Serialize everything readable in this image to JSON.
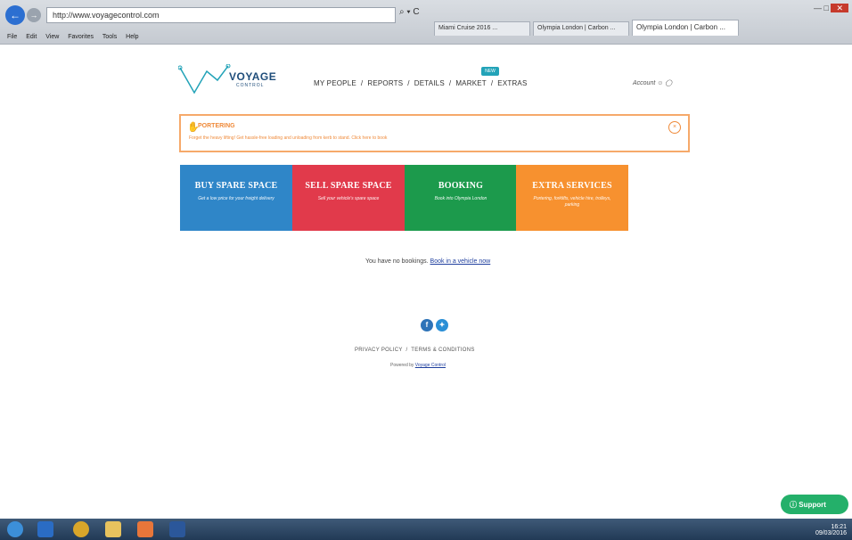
{
  "browser": {
    "address": "http://www.voyagecontrol.com",
    "search_icons": "⌕ ▾ C",
    "tabs": [
      {
        "label": "Miami Cruise 2016 ..."
      },
      {
        "label": "Olympia London | Carbon ..."
      },
      {
        "label": "Olympia London | Carbon ..."
      }
    ],
    "menu": [
      "File",
      "Edit",
      "View",
      "Favorites",
      "Tools",
      "Help"
    ]
  },
  "site": {
    "logo_text": "VOYAGE",
    "logo_sub": "CONTROL",
    "nav": [
      "MY PEOPLE",
      "REPORTS",
      "DETAILS",
      "MARKET",
      "EXTRAS"
    ],
    "nav_sep": "/",
    "new_badge": "NEW",
    "account": "Account"
  },
  "notice": {
    "title": "PORTERING",
    "text": "Forget the heavy lifting! Get hassle-free loading and unloading from kerb to stand. Click here to book"
  },
  "tiles": [
    {
      "title": "BUY SPARE SPACE",
      "desc": "Get a low price for your freight delivery"
    },
    {
      "title": "SELL SPARE SPACE",
      "desc": "Sell your vehicle's spare space"
    },
    {
      "title": "BOOKING",
      "desc": "Book into Olympia London"
    },
    {
      "title": "EXTRA SERVICES",
      "desc": "Portering, forklifts, vehicle hire, trolleys, parking"
    }
  ],
  "bookings": {
    "empty_text": "You have no bookings.",
    "link": "Book in a vehicle now"
  },
  "footer": {
    "privacy": "PRIVACY POLICY",
    "sep": "/",
    "terms": "TERMS & CONDITIONS",
    "powered_prefix": "Powered by",
    "powered_link": "Voyage Control"
  },
  "support_label": "Support",
  "colors": {
    "buy": "#2f86c8",
    "sell": "#e13a4b",
    "booking": "#1c9a4c",
    "extras": "#f7912f",
    "notice": "#ef8a3a",
    "support": "#24b06a"
  },
  "tray": {
    "time": "16:21",
    "date": "09/03/2016"
  }
}
